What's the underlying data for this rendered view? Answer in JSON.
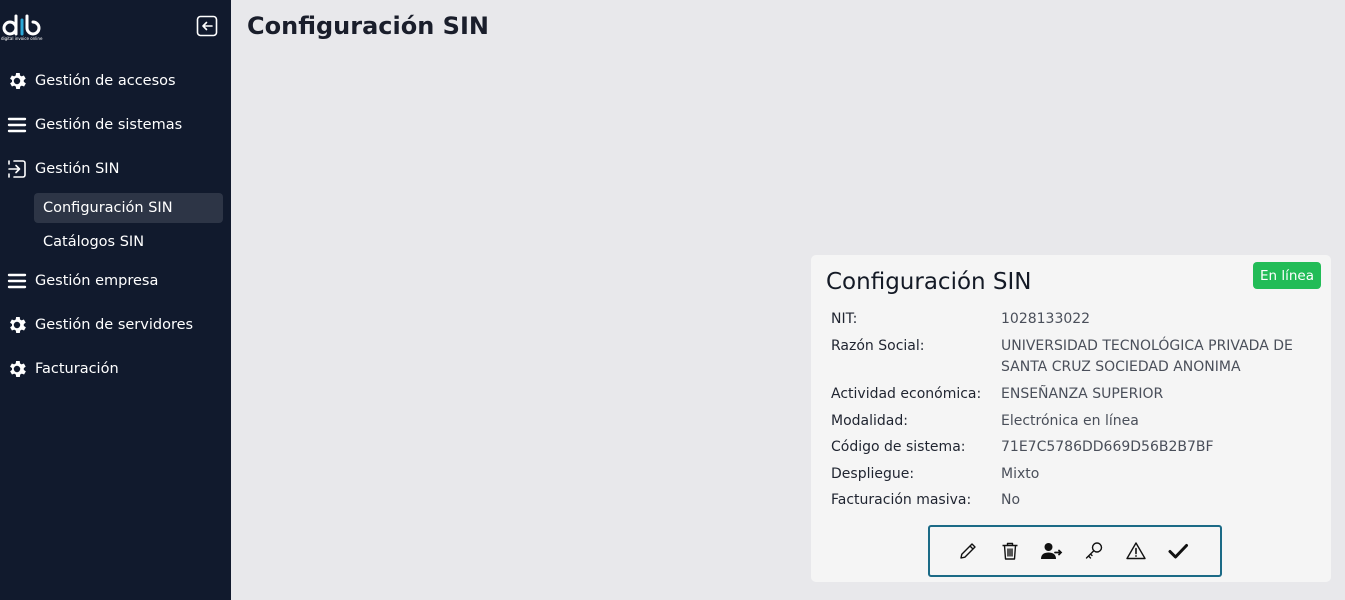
{
  "sidebar": {
    "logo": {
      "text": "digital invoice online"
    },
    "items": [
      {
        "label": "Gestión de accesos",
        "icon": "gear-icon"
      },
      {
        "label": "Gestión de sistemas",
        "icon": "menu-icon"
      },
      {
        "label": "Gestión SIN",
        "icon": "login-icon"
      },
      {
        "label": "Gestión empresa",
        "icon": "menu-icon"
      },
      {
        "label": "Gestión de servidores",
        "icon": "gear-icon"
      },
      {
        "label": "Facturación",
        "icon": "gear-icon"
      }
    ],
    "sub_items": [
      {
        "label": "Configuración SIN",
        "active": true
      },
      {
        "label": "Catálogos SIN",
        "active": false
      }
    ]
  },
  "header": {
    "title": "Configuración SIN"
  },
  "card": {
    "title": "Configuración SIN",
    "status": "En línea",
    "status_color": "#22bc57",
    "fields": [
      {
        "label": "NIT:",
        "value": "1028133022"
      },
      {
        "label": "Razón Social:",
        "value": "UNIVERSIDAD TECNOLÓGICA PRIVADA DE SANTA CRUZ SOCIEDAD ANONIMA"
      },
      {
        "label": "Actividad económica:",
        "value": "ENSEÑANZA SUPERIOR"
      },
      {
        "label": "Modalidad:",
        "value": "Electrónica en línea"
      },
      {
        "label": "Código de sistema:",
        "value": "71E7C5786DD669D56B2B7BF"
      },
      {
        "label": "Despliegue:",
        "value": "Mixto"
      },
      {
        "label": "Facturación masiva:",
        "value": "No"
      }
    ],
    "actions": [
      "edit-icon",
      "trash-icon",
      "user-assign-icon",
      "key-icon",
      "warning-icon",
      "check-icon"
    ]
  },
  "colors": {
    "sidebar_bg": "#111a2d",
    "accent": "#1b6a86",
    "active_item_bg": "#2d3546"
  }
}
